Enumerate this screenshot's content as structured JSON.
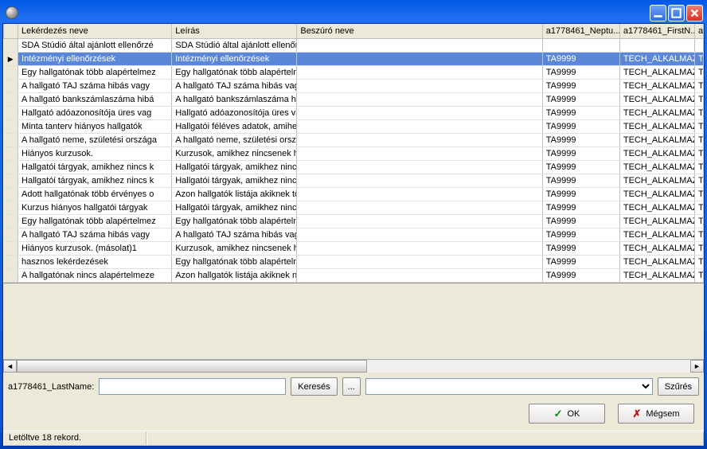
{
  "window": {
    "title": ""
  },
  "columns": {
    "c0": "Lekérdezés neve",
    "c1": "Leírás",
    "c2": "Beszúró neve",
    "c3": "a1778461_Neptu...",
    "c4": "a1778461_FirstN...",
    "c5": "a"
  },
  "rows": [
    {
      "c0": "SDA Stúdió által ajánlott ellenőrzé",
      "c1": "SDA Stúdió által ajánlott ellenőrzések",
      "c2": "",
      "c3": "",
      "c4": "",
      "sel": false
    },
    {
      "c0": "Intézményi ellenőrzések",
      "c1": "Intézményi ellenőrzések",
      "c2": "",
      "c3": "TA9999",
      "c4": "TECH_ALKALMAZO",
      "sel": true
    },
    {
      "c0": "Egy hallgatónak több alapértelmez",
      "c1": "Egy hallgatónak több alapértelmezett t",
      "c2": "",
      "c3": "TA9999",
      "c4": "TECH_ALKALMAZO",
      "sel": false
    },
    {
      "c0": "A hallgató TAJ száma hibás vagy",
      "c1": "A hallgató TAJ száma hibás vagy üres",
      "c2": "",
      "c3": "TA9999",
      "c4": "TECH_ALKALMAZO",
      "sel": false
    },
    {
      "c0": "A hallgató bankszámlaszáma hibá",
      "c1": "A hallgató bankszámlaszáma hibás (ho",
      "c2": "",
      "c3": "TA9999",
      "c4": "TECH_ALKALMAZO",
      "sel": false
    },
    {
      "c0": "Hallgató adóazonosítója üres vag",
      "c1": "Hallgató adóazonosítója üres vagy hib",
      "c2": "",
      "c3": "TA9999",
      "c4": "TECH_ALKALMAZO",
      "sel": false
    },
    {
      "c0": "Minta tanterv hiányos hallgatók",
      "c1": "Hallgatói féléves adatok, amihez nincs",
      "c2": "",
      "c3": "TA9999",
      "c4": "TECH_ALKALMAZO",
      "sel": false
    },
    {
      "c0": "A hallgató neme, születési országa",
      "c1": "A hallgató neme, születési országa, áll",
      "c2": "",
      "c3": "TA9999",
      "c4": "TECH_ALKALMAZO",
      "sel": false
    },
    {
      "c0": "Hiányos kurzusok.",
      "c1": "Kurzusok, amikhez nincsenek hallgató",
      "c2": "",
      "c3": "TA9999",
      "c4": "TECH_ALKALMAZO",
      "sel": false
    },
    {
      "c0": "Hallgatói tárgyak, amikhez nincs k",
      "c1": "Hallgatói tárgyak, amikhez nincs kurzu",
      "c2": "",
      "c3": "TA9999",
      "c4": "TECH_ALKALMAZO",
      "sel": false
    },
    {
      "c0": "Hallgatói tárgyak, amikhez nincs k",
      "c1": "Hallgatói tárgyak, amikhez nincs kurzu",
      "c2": "",
      "c3": "TA9999",
      "c4": "TECH_ALKALMAZO",
      "sel": false
    },
    {
      "c0": "Adott hallgatónak több érvényes o",
      "c1": "Azon hallgatók listája akiknek több érv",
      "c2": "",
      "c3": "TA9999",
      "c4": "TECH_ALKALMAZO",
      "sel": false
    },
    {
      "c0": "Kurzus hiányos hallgatói tárgyak",
      "c1": "Hallgatói tárgyak, amikhez nincs kurzu",
      "c2": "",
      "c3": "TA9999",
      "c4": "TECH_ALKALMAZO",
      "sel": false
    },
    {
      "c0": "Egy hallgatónak több alapértelmez",
      "c1": "Egy hallgatónak több alapértelmezett t",
      "c2": "",
      "c3": "TA9999",
      "c4": "TECH_ALKALMAZO",
      "sel": false
    },
    {
      "c0": "A hallgató TAJ száma hibás vagy",
      "c1": "A hallgató TAJ száma hibás vagy üres",
      "c2": "",
      "c3": "TA9999",
      "c4": "TECH_ALKALMAZO",
      "sel": false
    },
    {
      "c0": "Hiányos kurzusok. (másolat)1",
      "c1": "Kurzusok, amikhez nincsenek hallgató",
      "c2": "",
      "c3": "TA9999",
      "c4": "TECH_ALKALMAZO",
      "sel": false
    },
    {
      "c0": "hasznos lekérdezések",
      "c1": "Egy hallgatónak több alapértelmezett t",
      "c2": "",
      "c3": "TA9999",
      "c4": "TECH_ALKALMAZO",
      "sel": false
    },
    {
      "c0": "A hallgatónak nincs alapértelmeze",
      "c1": "Azon hallgatók listája akiknek nincs a",
      "c2": "",
      "c3": "TA9999",
      "c4": "TECH_ALKALMAZO",
      "sel": false
    }
  ],
  "search": {
    "label": "a1778461_LastName:",
    "value": "",
    "search_btn": "Keresés",
    "browse_btn": "...",
    "combo_value": "",
    "filter_btn": "Szűrés"
  },
  "actions": {
    "ok": "OK",
    "cancel": "Mégsem"
  },
  "status": {
    "text": "Letöltve 18 rekord."
  }
}
